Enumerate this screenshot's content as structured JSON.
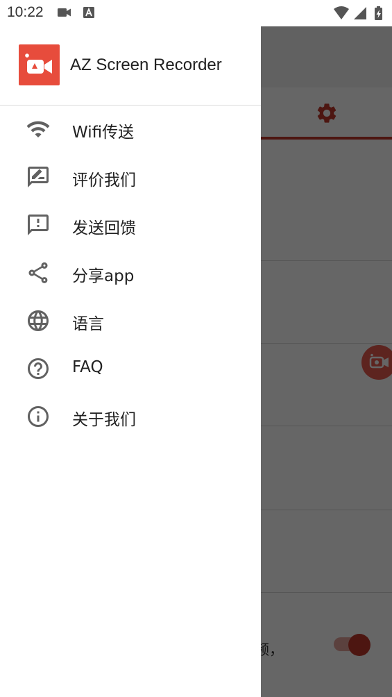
{
  "status_bar": {
    "time": "10:22",
    "left_icons": [
      "video-camera-icon",
      "accessibility-icon"
    ],
    "right_icons": [
      "wifi-icon",
      "signal-icon",
      "battery-charging-icon"
    ]
  },
  "drawer": {
    "app_name": "AZ Screen Recorder",
    "menu_items": [
      {
        "label": "Wifi传送",
        "icon": "wifi-icon"
      },
      {
        "label": "评价我们",
        "icon": "rate-feedback-icon"
      },
      {
        "label": "发送回馈",
        "icon": "report-feedback-icon"
      },
      {
        "label": "分享app",
        "icon": "share-icon"
      },
      {
        "label": "语言",
        "icon": "globe-icon"
      },
      {
        "label": "FAQ",
        "icon": "help-circle-icon"
      },
      {
        "label": "关于我们",
        "icon": "info-circle-icon"
      }
    ]
  },
  "background_app": {
    "settings_tab_icon": "settings-gear-icon",
    "visible_text_fragment": "频，",
    "floating_button_icon": "record-camera-icon",
    "toggle_state": "on"
  },
  "colors": {
    "brand_red": "#e74c3c",
    "accent_red": "#c0392b",
    "scrim": "rgba(0,0,0,0.6)",
    "icon_gray": "#616161",
    "text_dark": "#212121"
  }
}
